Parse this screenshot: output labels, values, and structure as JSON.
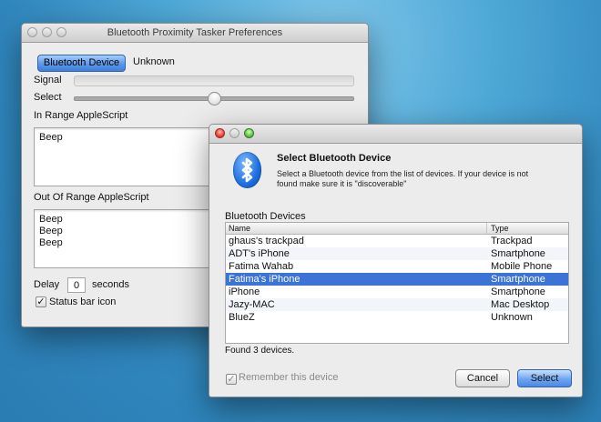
{
  "prefs": {
    "title": "Bluetooth Proximity Tasker Preferences",
    "device_button": "Bluetooth Device",
    "device_value": "Unknown",
    "signal_label": "Signal",
    "select_label": "Select",
    "in_range_label": "In Range AppleScript",
    "in_range_lines": [
      "Beep"
    ],
    "out_range_label": "Out Of Range AppleScript",
    "out_range_lines": [
      "Beep",
      "Beep",
      "Beep"
    ],
    "delay_label": "Delay",
    "delay_value": "0",
    "seconds_label": "seconds",
    "status_bar_label": "Status bar icon",
    "status_bar_checked": true,
    "select_slider_value": 0.5
  },
  "dialog": {
    "title": "Select Bluetooth Device",
    "description_line1": "Select a Bluetooth device from the list of devices. If your device is not",
    "description_line2": "found make sure it is \"discoverable\"",
    "table_label": "Bluetooth Devices",
    "columns": [
      "Name",
      "Type"
    ],
    "rows": [
      {
        "name": "ghaus's trackpad",
        "type": "Trackpad"
      },
      {
        "name": "ADT's iPhone",
        "type": "Smartphone"
      },
      {
        "name": "Fatima Wahab",
        "type": "Mobile Phone"
      },
      {
        "name": "Fatima's iPhone",
        "type": "Smartphone"
      },
      {
        "name": "iPhone",
        "type": "Smartphone"
      },
      {
        "name": "Jazy-MAC",
        "type": "Mac Desktop"
      },
      {
        "name": "BlueZ",
        "type": "Unknown"
      }
    ],
    "selected_index": 3,
    "found_text": "Found 3 devices.",
    "remember_label": "Remember this device",
    "cancel_label": "Cancel",
    "select_label": "Select"
  },
  "icons": {
    "checkmark": "✓",
    "bluetooth": "bluetooth-icon"
  },
  "colors": {
    "selection": "#3b73d6",
    "accent_blue": "#5b98ea"
  }
}
